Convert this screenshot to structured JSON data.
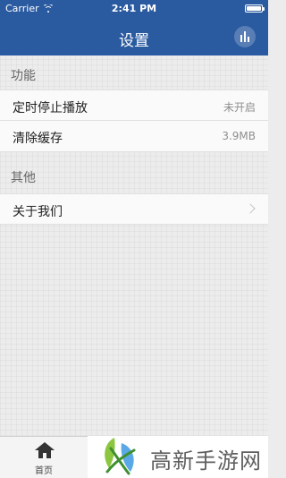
{
  "status_bar": {
    "carrier": "Carrier",
    "time": "2:41 PM"
  },
  "nav": {
    "title": "设置",
    "right_icon": "bar-chart-icon",
    "color": "#2a5aa0"
  },
  "sections": [
    {
      "header": "功能",
      "rows": [
        {
          "label": "定时停止播放",
          "value": "未开启"
        },
        {
          "label": "清除缓存",
          "value": "3.9MB"
        }
      ]
    },
    {
      "header": "其他",
      "rows": [
        {
          "label": "关于我们",
          "icon": "chevron-right-icon"
        }
      ]
    }
  ],
  "tab_bar": {
    "home": {
      "label": "首页",
      "icon": "home-icon"
    }
  },
  "watermark": {
    "text": "高新手游网",
    "logo": "leaf-logo"
  }
}
